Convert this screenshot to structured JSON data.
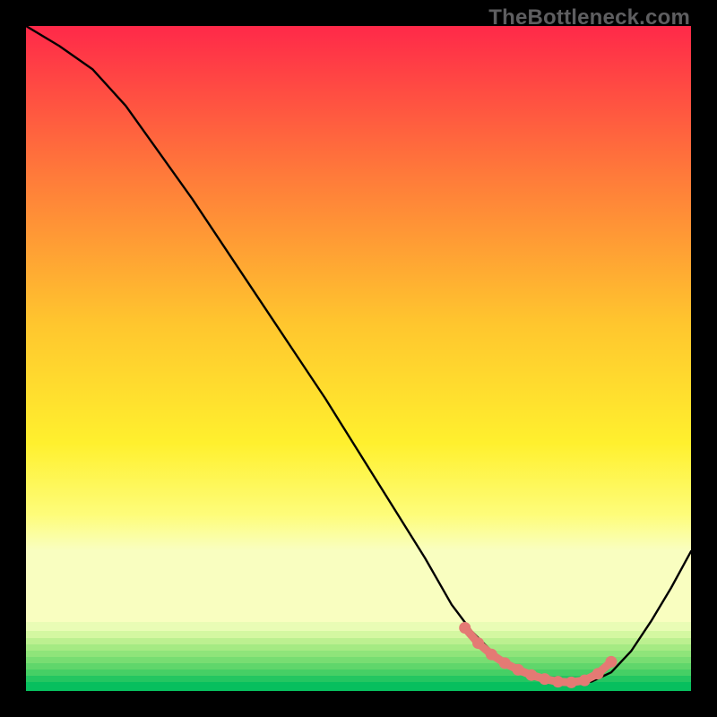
{
  "watermark": "TheBottleneck.com",
  "chart_data": {
    "type": "line",
    "title": "",
    "xlabel": "",
    "ylabel": "",
    "xlim": [
      0,
      100
    ],
    "ylim": [
      0,
      100
    ],
    "grid": false,
    "series": [
      {
        "name": "curve",
        "x": [
          0,
          5,
          10,
          15,
          20,
          25,
          30,
          35,
          40,
          45,
          50,
          55,
          60,
          64,
          67,
          70,
          73,
          76,
          79,
          82,
          85,
          88,
          91,
          94,
          97,
          100
        ],
        "y": [
          100,
          97,
          93.5,
          88,
          81,
          74,
          66.5,
          59,
          51.5,
          44,
          36,
          28,
          20,
          13,
          9,
          6,
          3.7,
          2.2,
          1.4,
          1.2,
          1.4,
          2.8,
          6,
          10.5,
          15.5,
          21
        ],
        "color": "#000000"
      },
      {
        "name": "min-region-markers",
        "type": "scatter",
        "x": [
          66,
          68,
          70,
          72,
          74,
          76,
          78,
          80,
          82,
          84,
          86,
          88
        ],
        "y": [
          9.5,
          7.2,
          5.5,
          4.2,
          3.2,
          2.4,
          1.8,
          1.4,
          1.3,
          1.6,
          2.6,
          4.4
        ],
        "color": "#E47A74"
      }
    ],
    "gradient_stops": [
      {
        "t": 0.0,
        "color": "#FF2949"
      },
      {
        "t": 0.25,
        "color": "#FF7A3A"
      },
      {
        "t": 0.5,
        "color": "#FFC62E"
      },
      {
        "t": 0.7,
        "color": "#FFF02E"
      },
      {
        "t": 0.82,
        "color": "#FEFD7A"
      },
      {
        "t": 0.88,
        "color": "#F9FEC0"
      }
    ],
    "bottom_stripes": [
      {
        "color": "#E9FCB5",
        "h": 10
      },
      {
        "color": "#D4F7A1",
        "h": 8
      },
      {
        "color": "#BCF090",
        "h": 7
      },
      {
        "color": "#A5EA83",
        "h": 7
      },
      {
        "color": "#8FE47A",
        "h": 7
      },
      {
        "color": "#78DD72",
        "h": 7
      },
      {
        "color": "#60D66B",
        "h": 7
      },
      {
        "color": "#46CF65",
        "h": 7
      },
      {
        "color": "#24C661",
        "h": 7
      },
      {
        "color": "#07BF5E",
        "h": 10
      }
    ]
  }
}
